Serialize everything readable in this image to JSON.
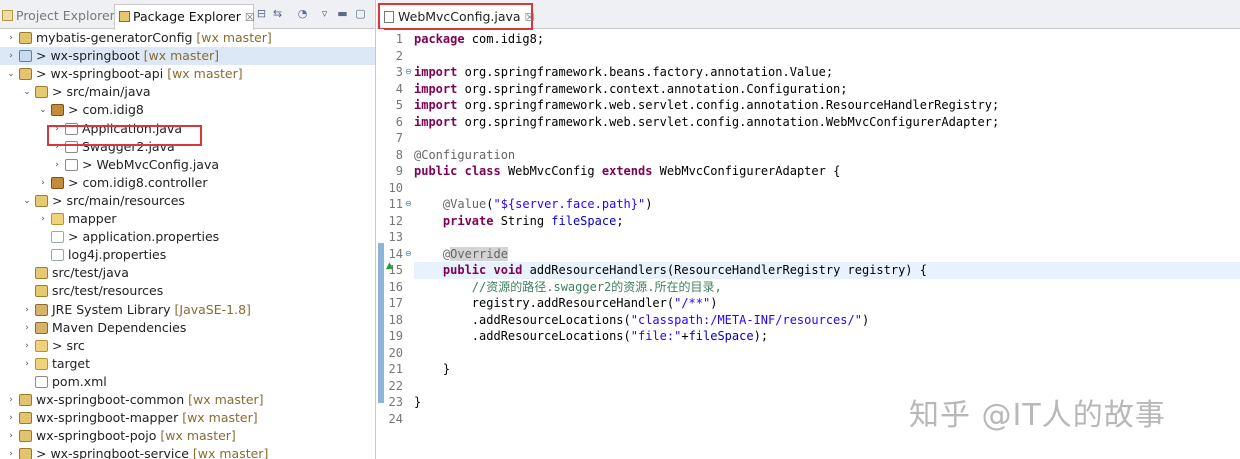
{
  "left_panel": {
    "tabs": [
      {
        "label": "Project Explorer"
      },
      {
        "label": "Package Explorer",
        "close": "☒"
      }
    ],
    "tree": [
      {
        "twisty": "›",
        "icon": "proj",
        "label": "mybatis-generatorConfig",
        "deco": "[wx master]"
      },
      {
        "twisty": "›",
        "icon": "proj-sel",
        "label": "> wx-springboot",
        "deco": "[wx master]"
      },
      {
        "twisty": "⌄",
        "icon": "proj",
        "label": "> wx-springboot-api",
        "deco": "[wx master]"
      },
      {
        "twisty": "⌄",
        "icon": "src",
        "label": "> src/main/java",
        "deco": ""
      },
      {
        "twisty": "⌄",
        "icon": "pkg",
        "label": "> com.idig8",
        "deco": ""
      },
      {
        "twisty": "›",
        "icon": "java",
        "label": "Application.java",
        "deco": ""
      },
      {
        "twisty": "›",
        "icon": "java",
        "label": "Swagger2.java",
        "deco": ""
      },
      {
        "twisty": "›",
        "icon": "java",
        "label": "> WebMvcConfig.java",
        "deco": ""
      },
      {
        "twisty": "›",
        "icon": "pkg",
        "label": "> com.idig8.controller",
        "deco": ""
      },
      {
        "twisty": "⌄",
        "icon": "src",
        "label": "> src/main/resources",
        "deco": ""
      },
      {
        "twisty": "›",
        "icon": "folder",
        "label": "mapper",
        "deco": ""
      },
      {
        "twisty": "",
        "icon": "file",
        "label": "> application.properties",
        "deco": ""
      },
      {
        "twisty": "",
        "icon": "file",
        "label": "log4j.properties",
        "deco": ""
      },
      {
        "twisty": "",
        "icon": "src",
        "label": "src/test/java",
        "deco": ""
      },
      {
        "twisty": "",
        "icon": "src",
        "label": "src/test/resources",
        "deco": ""
      },
      {
        "twisty": "›",
        "icon": "lib",
        "label": "JRE System Library",
        "deco": "[JavaSE-1.8]"
      },
      {
        "twisty": "›",
        "icon": "lib",
        "label": "Maven Dependencies",
        "deco": ""
      },
      {
        "twisty": "›",
        "icon": "folder",
        "label": "> src",
        "deco": ""
      },
      {
        "twisty": "›",
        "icon": "folder",
        "label": "target",
        "deco": ""
      },
      {
        "twisty": "",
        "icon": "xml",
        "label": "pom.xml",
        "deco": ""
      },
      {
        "twisty": "›",
        "icon": "proj",
        "label": "wx-springboot-common",
        "deco": "[wx master]"
      },
      {
        "twisty": "›",
        "icon": "proj",
        "label": "wx-springboot-mapper",
        "deco": "[wx master]"
      },
      {
        "twisty": "›",
        "icon": "proj",
        "label": "wx-springboot-pojo",
        "deco": "[wx master]"
      },
      {
        "twisty": "›",
        "icon": "proj",
        "label": "> wx-springboot-service",
        "deco": "[wx master]"
      }
    ]
  },
  "editor": {
    "tab_label": "WebMvcConfig.java",
    "tab_close": "☒",
    "line_numbers": [
      "1",
      "2",
      "3",
      "4",
      "5",
      "6",
      "7",
      "8",
      "9",
      "10",
      "11",
      "12",
      "13",
      "14",
      "15",
      "16",
      "17",
      "18",
      "19",
      "20",
      "21",
      "22",
      "23",
      "24"
    ],
    "lines": [
      [
        [
          "kw",
          "package"
        ],
        [
          "t",
          " com.idig8;"
        ]
      ],
      [],
      [
        [
          "kw",
          "import"
        ],
        [
          "t",
          " org.springframework.beans.factory.annotation.Value;"
        ]
      ],
      [
        [
          "kw",
          "import"
        ],
        [
          "t",
          " org.springframework.context.annotation.Configuration;"
        ]
      ],
      [
        [
          "kw",
          "import"
        ],
        [
          "t",
          " org.springframework.web.servlet.config.annotation.ResourceHandlerRegistry;"
        ]
      ],
      [
        [
          "kw",
          "import"
        ],
        [
          "t",
          " org.springframework.web.servlet.config.annotation.WebMvcConfigurerAdapter;"
        ]
      ],
      [],
      [
        [
          "an",
          "@Configuration"
        ]
      ],
      [
        [
          "kw",
          "public"
        ],
        [
          "t",
          " "
        ],
        [
          "kw",
          "class"
        ],
        [
          "t",
          " WebMvcConfig "
        ],
        [
          "kw",
          "extends"
        ],
        [
          "t",
          " WebMvcConfigurerAdapter {"
        ]
      ],
      [],
      [
        [
          "t",
          "    "
        ],
        [
          "an",
          "@Value"
        ],
        [
          "t",
          "("
        ],
        [
          "st",
          "\"${server.face.path}\""
        ],
        [
          "t",
          ")"
        ]
      ],
      [
        [
          "t",
          "    "
        ],
        [
          "kw",
          "private"
        ],
        [
          "t",
          " String "
        ],
        [
          "fd",
          "fileSpace"
        ],
        [
          "t",
          ";"
        ]
      ],
      [],
      [
        [
          "t",
          "    "
        ],
        [
          "an",
          "@"
        ],
        [
          "an-hl",
          "Override"
        ]
      ],
      [
        [
          "t",
          "    "
        ],
        [
          "kw",
          "public"
        ],
        [
          "t",
          " "
        ],
        [
          "kw",
          "void"
        ],
        [
          "t",
          " addResourceHandlers(ResourceHandlerRegistry registry) {"
        ]
      ],
      [
        [
          "t",
          "        "
        ],
        [
          "cm",
          "//资源的路径.swagger2的资源.所在的目录,"
        ]
      ],
      [
        [
          "t",
          "        registry.addResourceHandler("
        ],
        [
          "st",
          "\"/**\""
        ],
        [
          "t",
          ")"
        ]
      ],
      [
        [
          "t",
          "        .addResourceLocations("
        ],
        [
          "st",
          "\"classpath:/META-INF/resources/\""
        ],
        [
          "t",
          ")"
        ]
      ],
      [
        [
          "t",
          "        .addResourceLocations("
        ],
        [
          "st",
          "\"file:\""
        ],
        [
          "t",
          "+"
        ],
        [
          "fd",
          "fileSpace"
        ],
        [
          "t",
          ");"
        ]
      ],
      [],
      [
        [
          "t",
          "    }"
        ]
      ],
      [],
      [
        [
          "t",
          "}"
        ]
      ],
      []
    ],
    "fold_markers": {
      "3": "⊖",
      "11": "⊖",
      "14": "⊖"
    },
    "override_marker_line": "15",
    "current_line": 15
  },
  "watermark": "知乎 @IT人的故事"
}
